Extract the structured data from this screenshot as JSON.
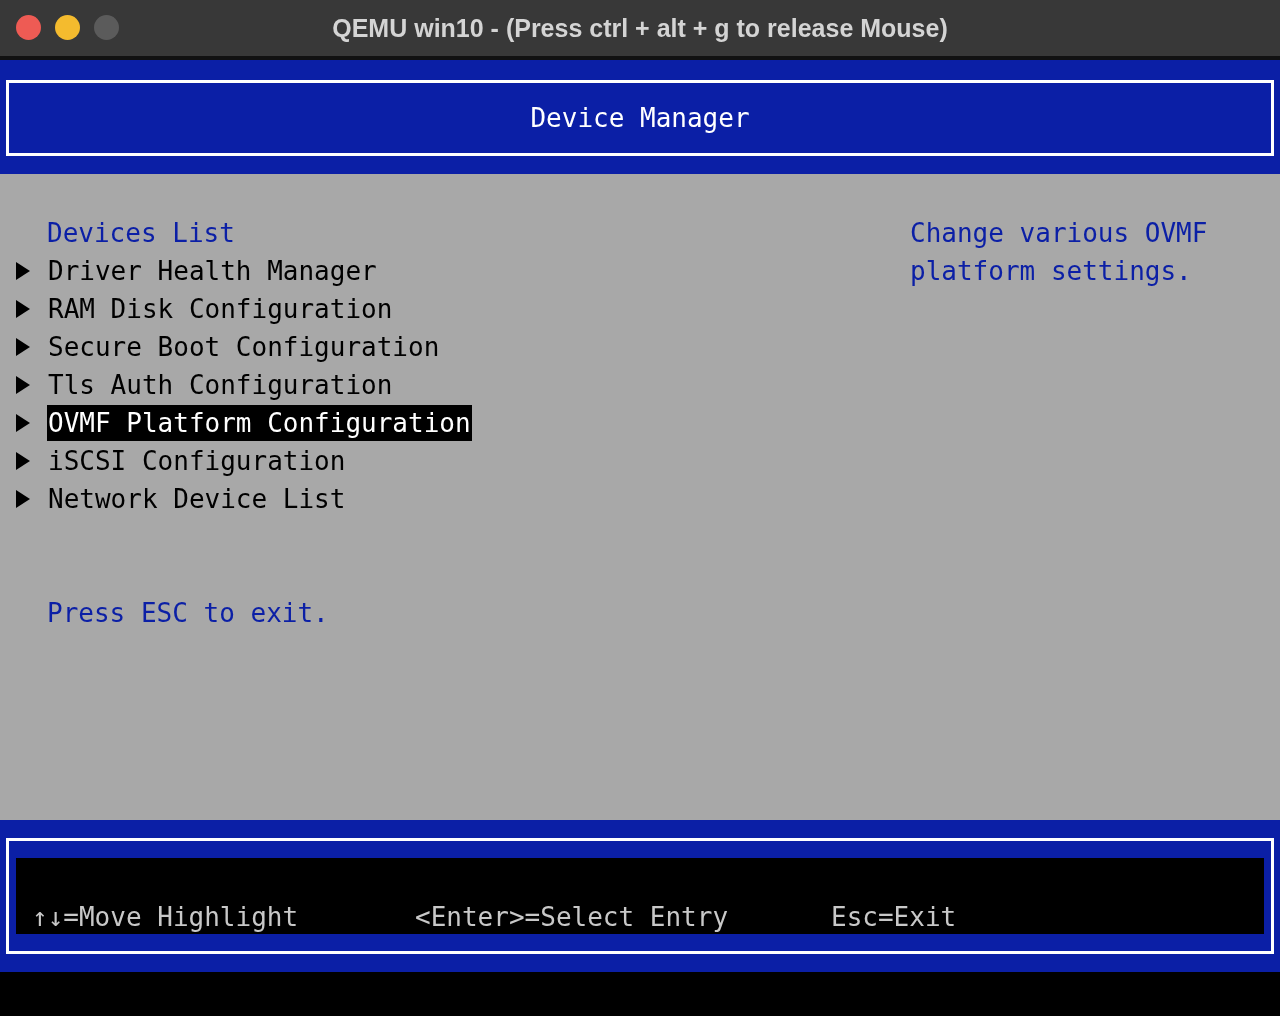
{
  "window": {
    "title": "QEMU win10 - (Press ctrl + alt + g to release Mouse)"
  },
  "header": {
    "title": "Device Manager"
  },
  "section_title": "Devices List",
  "menu": [
    {
      "label": "Driver Health Manager",
      "selected": false
    },
    {
      "label": "RAM Disk Configuration",
      "selected": false
    },
    {
      "label": "Secure Boot Configuration",
      "selected": false
    },
    {
      "label": "Tls Auth Configuration",
      "selected": false
    },
    {
      "label": "OVMF Platform Configuration",
      "selected": true
    },
    {
      "label": "iSCSI Configuration",
      "selected": false
    },
    {
      "label": "Network Device List",
      "selected": false
    }
  ],
  "exit_hint": "Press ESC to exit.",
  "help_text": "Change various OVMF platform settings.",
  "footer": [
    "↑↓=Move Highlight",
    "<Enter>=Select Entry",
    "Esc=Exit"
  ]
}
